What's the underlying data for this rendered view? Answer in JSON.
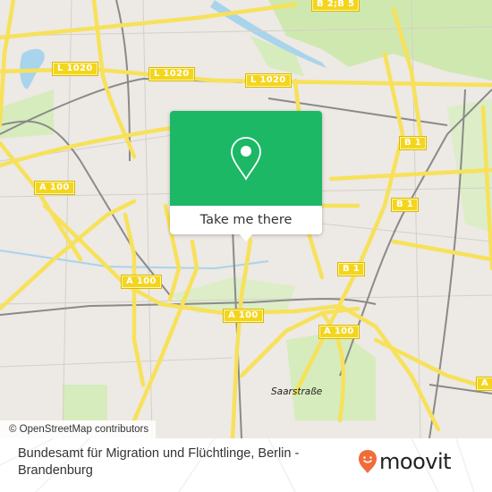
{
  "map": {
    "road_shields": [
      {
        "label": "L 1020",
        "id": "l1020-west"
      },
      {
        "label": "L 1020",
        "id": "l1020-center"
      },
      {
        "label": "L 1020",
        "id": "l1020-east"
      },
      {
        "label": "B 2;B 5",
        "id": "b2b5"
      },
      {
        "label": "B 1",
        "id": "b1-north"
      },
      {
        "label": "B 1",
        "id": "b1-mid"
      },
      {
        "label": "B 1",
        "id": "b1-south"
      },
      {
        "label": "A 100",
        "id": "a100-west"
      },
      {
        "label": "A 100",
        "id": "a100-southwest"
      },
      {
        "label": "A 100",
        "id": "a100-center"
      },
      {
        "label": "A 100",
        "id": "a100-east"
      },
      {
        "label": "A",
        "id": "a100-far-east"
      }
    ],
    "place_labels": [
      {
        "label": "Saarstraße"
      }
    ],
    "colors": {
      "land": "#ede9e4",
      "park": "#cfe8b0",
      "water": "#a8d4ec",
      "major_road": "#f7e15a",
      "rail": "#8a8a8a"
    }
  },
  "popup": {
    "icon": "location-pin-icon",
    "button_label": "Take me there",
    "color": "#1cb866"
  },
  "attribution": "© OpenStreetMap contributors",
  "footer": {
    "title": "Bundesamt für Migration und Flüchtlinge, Berlin - Brandenburg",
    "logo_text": "moovit",
    "logo_color": "#f26b3a"
  }
}
